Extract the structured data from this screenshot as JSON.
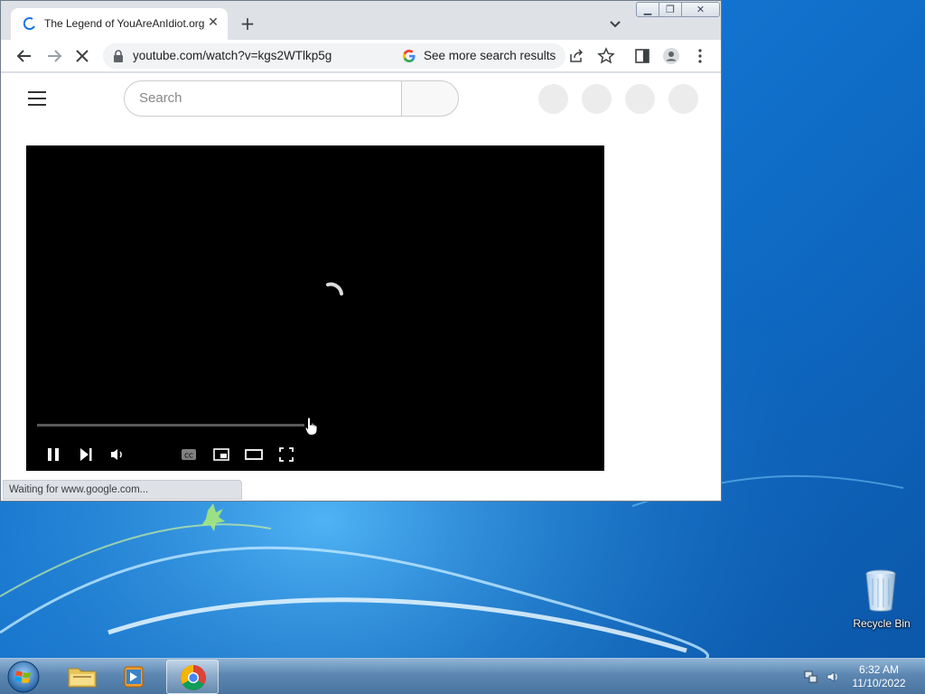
{
  "browser": {
    "tab_title": "The Legend of YouAreAnIdiot.org",
    "url": "youtube.com/watch?v=kgs2WTlkp5g",
    "search_chip": "See more search results",
    "status_text": "Waiting for www.google.com..."
  },
  "youtube": {
    "search_placeholder": "Search"
  },
  "player": {
    "loading": true
  },
  "desktop": {
    "recycle_bin_label": "Recycle Bin"
  },
  "taskbar": {
    "time": "6:32 AM",
    "date": "11/10/2022",
    "pinned": [
      "windows-explorer-icon",
      "media-player-icon",
      "chrome-icon"
    ]
  },
  "colors": {
    "accent": "#1a73e8",
    "taskbar": "#5c87b2",
    "wallpaper": "#1478d4"
  }
}
